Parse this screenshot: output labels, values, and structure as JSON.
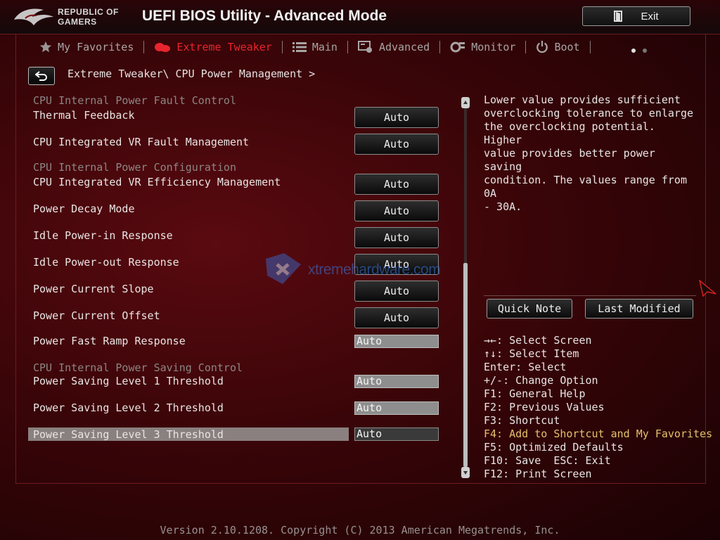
{
  "header": {
    "brand_line1": "REPUBLIC OF",
    "brand_line2": "GAMERS",
    "title": "UEFI BIOS Utility - Advanced Mode",
    "exit_label": "Exit"
  },
  "tabs": [
    {
      "label": "My Favorites",
      "icon": "star-icon",
      "active": false
    },
    {
      "label": "Extreme Tweaker",
      "icon": "tweaker-icon",
      "active": true
    },
    {
      "label": "Main",
      "icon": "list-icon",
      "active": false
    },
    {
      "label": "Advanced",
      "icon": "advanced-icon",
      "active": false
    },
    {
      "label": "Monitor",
      "icon": "monitor-icon",
      "active": false
    },
    {
      "label": "Boot",
      "icon": "power-icon",
      "active": false
    }
  ],
  "breadcrumb": "Extreme Tweaker\\ CPU Power Management >",
  "sections": {
    "fault": "CPU Internal Power Fault Control",
    "config": "CPU Internal Power Configuration",
    "saving": "CPU Internal Power Saving Control"
  },
  "settings": [
    {
      "label": "Thermal Feedback",
      "value": "Auto"
    },
    {
      "label": "CPU Integrated VR Fault Management",
      "value": "Auto"
    },
    {
      "label": "CPU Integrated VR Efficiency Management",
      "value": "Auto"
    },
    {
      "label": "Power Decay Mode",
      "value": "Auto"
    },
    {
      "label": "Idle Power-in Response",
      "value": "Auto"
    },
    {
      "label": "Idle Power-out Response",
      "value": "Auto"
    },
    {
      "label": "Power Current Slope",
      "value": "Auto"
    },
    {
      "label": "Power Current Offset",
      "value": "Auto"
    },
    {
      "label": "Power Fast Ramp Response",
      "value": "Auto"
    },
    {
      "label": "Power Saving Level 1 Threshold",
      "value": "Auto"
    },
    {
      "label": "Power Saving Level 2 Threshold",
      "value": "Auto"
    },
    {
      "label": "Power Saving Level 3 Threshold",
      "value": "Auto"
    }
  ],
  "help_text": "Lower value provides sufficient\noverclocking tolerance to enlarge\nthe overclocking potential. Higher\nvalue provides better power saving\ncondition. The values range from 0A\n- 30A.",
  "side_buttons": {
    "quick_note": "Quick Note",
    "last_modified": "Last Modified"
  },
  "keys": [
    "→←: Select Screen",
    "↑↓: Select Item",
    "Enter: Select",
    "+/-: Change Option",
    "F1: General Help",
    "F2: Previous Values",
    "F3: Shortcut",
    "F4: Add to Shortcut and My Favorites",
    "F5: Optimized Defaults",
    "F10: Save  ESC: Exit",
    "F12: Print Screen"
  ],
  "watermark": "xtremehardware.com",
  "footer": "Version 2.10.1208. Copyright (C) 2013 American Megatrends, Inc.",
  "colors": {
    "accent": "#e8252e",
    "highlight_key": "#e6c06a",
    "selected_row": "#8a8080"
  }
}
